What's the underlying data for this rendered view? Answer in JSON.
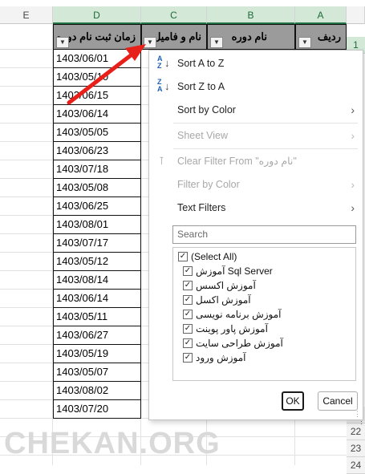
{
  "columns": {
    "E": "E",
    "D": "D",
    "C": "C",
    "B": "B",
    "A": "A"
  },
  "row_numbers": {
    "r1": "1",
    "r21": "21",
    "r22": "22",
    "r23": "23",
    "r24": "24"
  },
  "headers": {
    "col_a": "ردیف",
    "col_b": "نام دوره",
    "col_c": "نام و فامیل",
    "col_d": "زمان ثبت نام دوره"
  },
  "dates": [
    "1403/06/01",
    "1403/05/10",
    "1403/06/15",
    "1403/06/14",
    "1403/05/05",
    "1403/06/23",
    "1403/07/18",
    "1403/05/08",
    "1403/06/25",
    "1403/08/01",
    "1403/07/17",
    "1403/05/12",
    "1403/08/14",
    "1403/06/14",
    "1403/05/11",
    "1403/06/27",
    "1403/05/19",
    "1403/05/07",
    "1403/08/02",
    "1403/07/20"
  ],
  "menu": {
    "sort_az": "Sort A to Z",
    "sort_za": "Sort Z to A",
    "sort_by_color": "Sort by Color",
    "sheet_view": "Sheet View",
    "clear_filter": "Clear Filter From \"نام دوره\"",
    "filter_by_color": "Filter by Color",
    "text_filters": "Text Filters",
    "search_placeholder": "Search",
    "items": [
      "(Select All)",
      "آموزش Sql Server",
      "آموزش اکسس",
      "آموزش اکسل",
      "آموزش برنامه نویسی",
      "آموزش پاور پوینت",
      "آموزش طراحی سایت",
      "آموزش ورود"
    ],
    "ok": "OK",
    "cancel": "Cancel"
  },
  "watermark": "CHEKAN.ORG",
  "accent_color": "#217346",
  "arrow_color": "#e8201a"
}
